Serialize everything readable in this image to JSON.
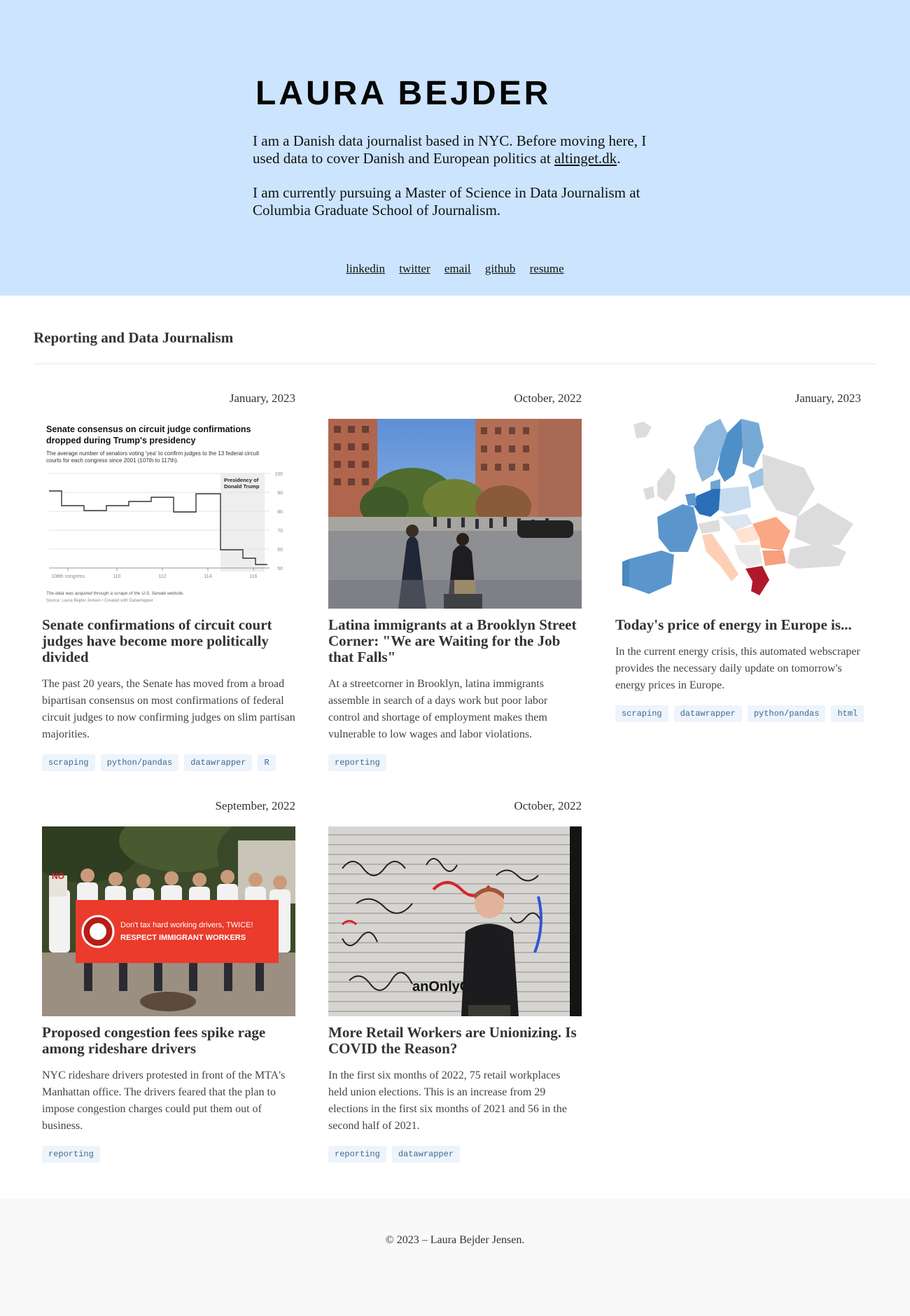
{
  "hero": {
    "name": "LAURA BEJDER",
    "bio1_text": "I am a Danish data journalist based in NYC. Before moving here, I used data to cover Danish and European politics at ",
    "bio1_link": "altinget.dk",
    "bio1_end": ".",
    "bio2": "I am currently pursuing a Master of Science in Data Journalism at Columbia Graduate School of Journalism.",
    "links": [
      "linkedin",
      "twitter",
      "email",
      "github",
      "resume"
    ]
  },
  "section": {
    "title": "Reporting and Data Journalism"
  },
  "cards": [
    {
      "date": "January, 2023",
      "title": "Senate confirmations of circuit court judges have become more politically divided",
      "description": "The past 20 years, the Senate has moved from a broad bipartisan consensus on most confirmations of federal circuit judges to now confirming judges on slim partisan majorities.",
      "tags": [
        "scraping",
        "python/pandas",
        "datawrapper",
        "R"
      ],
      "thumb": {
        "chart_title": "Senate consensus on circuit judge confirmations dropped during Trump's presidency",
        "chart_subtitle": "The average number of senators voting 'yea' to confirm judges to the 13 federal circuit courts for each congress since 2001 (107th to 117th).",
        "highlight_label_1": "Presidency of",
        "highlight_label_2": "Donald Trump",
        "y_ticks": [
          "100",
          "90",
          "80",
          "70",
          "60",
          "50"
        ],
        "x_ticks": [
          "108th congress",
          "110",
          "112",
          "114",
          "116"
        ],
        "note": "The data was acquired through a scrape of the U.S. Senate website.",
        "source": "Source: Laura Bejder Jensen • Created with Datawrapper"
      }
    },
    {
      "date": "October, 2022",
      "title": "Latina immigrants at a Brooklyn Street Corner: \"We are Waiting for the Job that Falls\"",
      "description": "At a streetcorner in Brooklyn, latina immigrants assemble in search of a days work but poor labor control and shortage of employment makes them vulnerable to low wages and labor violations.",
      "tags": [
        "reporting"
      ]
    },
    {
      "date": "January, 2023",
      "title": "Today's price of energy in Europe is...",
      "description": "In the current energy crisis, this automated webscraper provides the necessary daily update on tomorrow's energy prices in Europe.",
      "tags": [
        "scraping",
        "datawrapper",
        "python/pandas",
        "html"
      ]
    },
    {
      "date": "September, 2022",
      "title": "Proposed congestion fees spike rage among rideshare drivers",
      "description": "NYC rideshare drivers protested in front of the MTA's Manhattan office. The drivers feared that the plan to impose congestion charges could put them out of business.",
      "tags": [
        "reporting"
      ],
      "thumb": {
        "banner_line1": "Don't tax hard working drivers, TWICE!",
        "banner_line2": "RESPECT IMMIGRANT WORKERS",
        "sign": "NO"
      }
    },
    {
      "date": "October, 2022",
      "title": "More Retail Workers are Unionizing. Is COVID the Reason?",
      "description": "In the first six months of 2022, 75 retail workplaces held union elections. This is an increase from 29 elections in the first six months of 2021 and 56 in the second half of 2021.",
      "tags": [
        "reporting",
        "datawrapper"
      ],
      "thumb": {
        "graffiti": "anOnlyCh"
      }
    }
  ],
  "footer": {
    "copyright": "© 2023 – Laura Bejder Jensen."
  },
  "colors": {
    "hero_bg": "#cce4fe",
    "tag_bg": "#eef4fb",
    "tag_text": "#3a6a91",
    "footer_bg": "#f9f9f9"
  }
}
